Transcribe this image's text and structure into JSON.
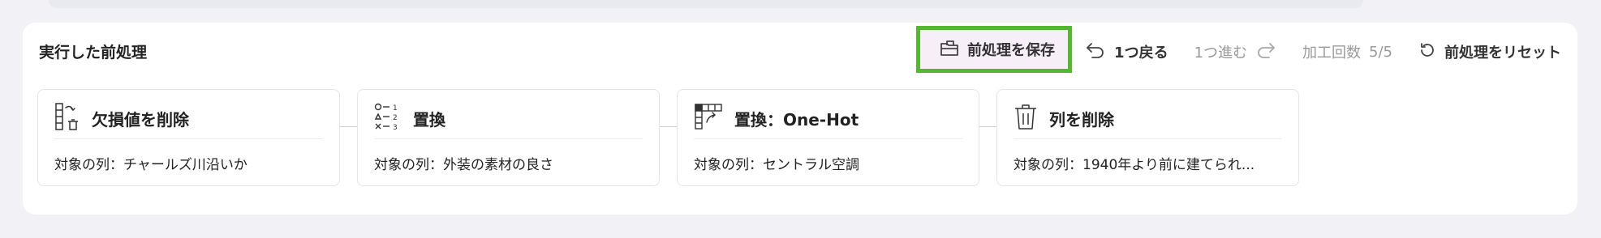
{
  "panel": {
    "title": "実行した前処理"
  },
  "toolbar": {
    "save_label": "前処理を保存",
    "undo_label": "1つ戻る",
    "redo_label": "1つ進む",
    "count_label": "加工回数",
    "count_value": "5/5",
    "reset_label": "前処理をリセット"
  },
  "cards": [
    {
      "icon": "delete-missing-values-icon",
      "title": "欠損値を削除",
      "target": "対象の列：チャールズ川沿いか"
    },
    {
      "icon": "replace-icon",
      "title": "置換",
      "target": "対象の列：外装の素材の良さ"
    },
    {
      "icon": "one-hot-icon",
      "title": "置換：One-Hot",
      "target": "対象の列：セントラル空調"
    },
    {
      "icon": "trash-icon",
      "title": "列を削除",
      "target": "対象の列：1940年より前に建てられ..."
    }
  ],
  "colors": {
    "save_highlight_border": "#53b82f",
    "save_highlight_bg": "#f7eff8",
    "disabled_text": "#9a9a9a"
  }
}
